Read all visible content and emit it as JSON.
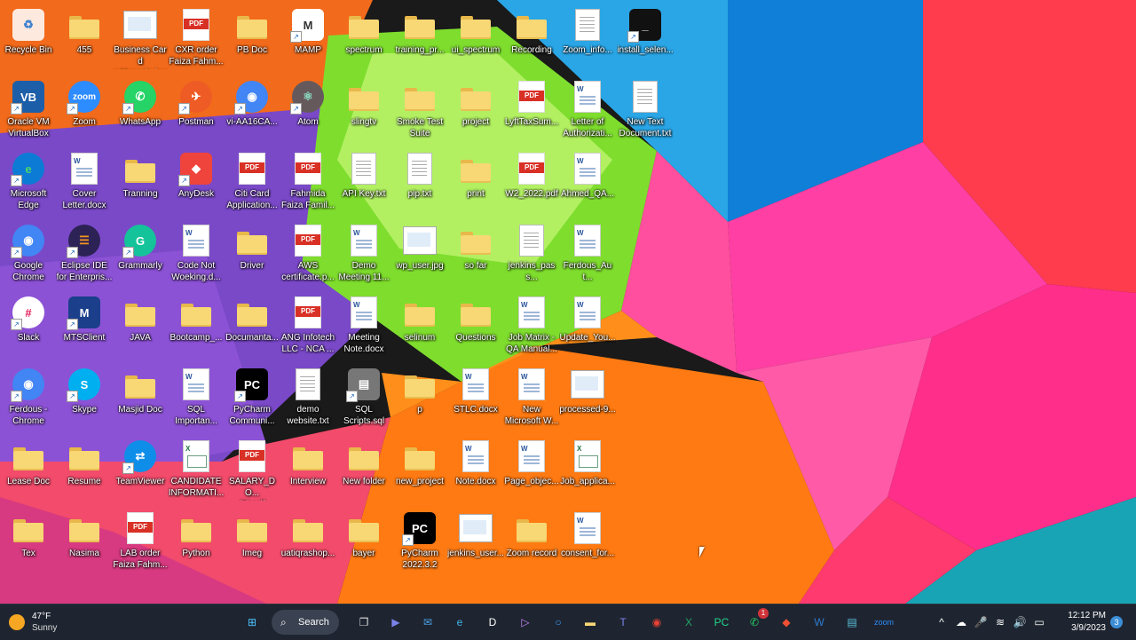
{
  "desktop": {
    "icons": [
      {
        "label": "Recycle Bin",
        "type": "recycle",
        "icon": "recycle-bin-icon"
      },
      {
        "label": "455",
        "type": "folder",
        "icon": "folder-icon"
      },
      {
        "label": "Business Card\nz Hossain.jpg",
        "type": "image",
        "icon": "image-file-icon"
      },
      {
        "label": "CXR order\nFaiza Fahm...",
        "type": "pdf",
        "icon": "pdf-file-icon"
      },
      {
        "label": "PB Doc",
        "type": "folder",
        "icon": "folder-icon"
      },
      {
        "label": "MAMP",
        "type": "app",
        "icon": "mamp-icon",
        "bg": "#ffffff",
        "fg": "#333333",
        "glyph": "M"
      },
      {
        "label": "spectrum",
        "type": "folder",
        "icon": "folder-icon"
      },
      {
        "label": "training_pr...",
        "type": "folder",
        "icon": "folder-icon"
      },
      {
        "label": "ui_spectrum",
        "type": "folder",
        "icon": "folder-icon"
      },
      {
        "label": "Recording",
        "type": "folder",
        "icon": "folder-icon"
      },
      {
        "label": "Zoom_info...",
        "type": "txt",
        "icon": "text-file-icon"
      },
      {
        "label": "install_selen...",
        "type": "app",
        "icon": "console-file-icon",
        "bg": "#111111",
        "fg": "#ffffff",
        "glyph": "_"
      },
      {
        "label": "Oracle VM\nVirtualBox",
        "type": "app",
        "icon": "virtualbox-icon",
        "bg": "#1d5ea8",
        "fg": "#ffffff",
        "glyph": "VB"
      },
      {
        "label": "Zoom",
        "type": "app",
        "icon": "zoom-icon",
        "bg": "#2d8cff",
        "fg": "#ffffff",
        "glyph": "zoom",
        "round": true
      },
      {
        "label": "WhatsApp",
        "type": "app",
        "icon": "whatsapp-icon",
        "bg": "#25d366",
        "fg": "#ffffff",
        "glyph": "✆",
        "round": true
      },
      {
        "label": "Postman",
        "type": "app",
        "icon": "postman-icon",
        "bg": "#ef5b25",
        "fg": "#ffffff",
        "glyph": "✈",
        "round": true
      },
      {
        "label": "vi-AA16CA...",
        "type": "app",
        "icon": "chrome-icon",
        "bg": "#4285f4",
        "fg": "#ffffff",
        "glyph": "◉",
        "round": true
      },
      {
        "label": "Atom",
        "type": "app",
        "icon": "atom-icon",
        "bg": "#66595c",
        "fg": "#8be0c5",
        "glyph": "⚛",
        "round": true
      },
      {
        "label": "slingtv",
        "type": "folder",
        "icon": "folder-icon"
      },
      {
        "label": "Smoke Test\nSuite",
        "type": "folder",
        "icon": "folder-icon"
      },
      {
        "label": "project",
        "type": "folder",
        "icon": "folder-icon"
      },
      {
        "label": "LyftTaxSum...",
        "type": "pdf",
        "icon": "pdf-file-icon"
      },
      {
        "label": "Letter of\nAuthorizati...",
        "type": "doc",
        "icon": "word-file-icon"
      },
      {
        "label": "New Text\nDocument.txt",
        "type": "txt",
        "icon": "text-file-icon"
      },
      {
        "label": "Microsoft\nEdge",
        "type": "app",
        "icon": "edge-icon",
        "bg": "#0c7bd5",
        "fg": "#4fd36c",
        "glyph": "e",
        "round": true
      },
      {
        "label": "Cover\nLetter.docx",
        "type": "doc",
        "icon": "word-file-icon"
      },
      {
        "label": "Tranning",
        "type": "folder",
        "icon": "folder-icon"
      },
      {
        "label": "AnyDesk",
        "type": "app",
        "icon": "anydesk-icon",
        "bg": "#ef443b",
        "fg": "#ffffff",
        "glyph": "◆"
      },
      {
        "label": "Citi Card\nApplication...",
        "type": "pdf",
        "icon": "pdf-file-icon"
      },
      {
        "label": "Fahmida\nFaiza Famil...",
        "type": "pdf",
        "icon": "pdf-file-icon"
      },
      {
        "label": "API Key.txt",
        "type": "txt",
        "icon": "text-file-icon"
      },
      {
        "label": "pip.txt",
        "type": "txt",
        "icon": "text-file-icon"
      },
      {
        "label": "print",
        "type": "folder",
        "icon": "folder-icon"
      },
      {
        "label": "W2_2022.pdf",
        "type": "pdf",
        "icon": "pdf-file-icon"
      },
      {
        "label": "Ahmed_QA...",
        "type": "doc",
        "icon": "word-file-icon"
      },
      {
        "label": "Google\nChrome",
        "type": "app",
        "icon": "chrome-icon",
        "bg": "#4285f4",
        "fg": "#ffffff",
        "glyph": "◉",
        "round": true
      },
      {
        "label": "Eclipse IDE\nfor Enterpris...",
        "type": "app",
        "icon": "eclipse-icon",
        "bg": "#2c2255",
        "fg": "#f7941e",
        "glyph": "☰",
        "round": true
      },
      {
        "label": "Grammarly",
        "type": "app",
        "icon": "grammarly-icon",
        "bg": "#15c39a",
        "fg": "#ffffff",
        "glyph": "G",
        "round": true
      },
      {
        "label": "Code Not\nWoeking.d...",
        "type": "doc",
        "icon": "word-file-icon"
      },
      {
        "label": "Driver",
        "type": "folder",
        "icon": "folder-icon"
      },
      {
        "label": "AWS\ncertificate.p...",
        "type": "pdf",
        "icon": "pdf-file-icon"
      },
      {
        "label": "Demo\nMeeting 11...",
        "type": "doc",
        "icon": "word-file-icon"
      },
      {
        "label": "wp_user.jpg",
        "type": "image",
        "icon": "image-file-icon"
      },
      {
        "label": "so far",
        "type": "folder",
        "icon": "folder-icon"
      },
      {
        "label": "jenkins_pass...",
        "type": "txt",
        "icon": "text-file-icon"
      },
      {
        "label": "Ferdous_Aut...",
        "type": "doc",
        "icon": "word-file-icon"
      },
      {
        "label": "Slack",
        "type": "app",
        "icon": "slack-icon",
        "bg": "#ffffff",
        "fg": "#e01e5a",
        "glyph": "#",
        "round": true
      },
      {
        "label": "MTSClient",
        "type": "app",
        "icon": "mtsclient-icon",
        "bg": "#1b3f8b",
        "fg": "#ffffff",
        "glyph": "M"
      },
      {
        "label": "JAVA",
        "type": "folder",
        "icon": "folder-icon"
      },
      {
        "label": "Bootcamp_...",
        "type": "folder",
        "icon": "folder-icon"
      },
      {
        "label": "Documanta...",
        "type": "folder",
        "icon": "folder-icon"
      },
      {
        "label": "ANG Infotech\nLLC - NCA ...",
        "type": "pdf",
        "icon": "pdf-file-icon"
      },
      {
        "label": "Meeting\nNote.docx",
        "type": "doc",
        "icon": "word-file-icon"
      },
      {
        "label": "selinum",
        "type": "folder",
        "icon": "folder-icon"
      },
      {
        "label": "Questions",
        "type": "folder",
        "icon": "folder-icon"
      },
      {
        "label": "Job Matrix -\nQA Manual...",
        "type": "doc",
        "icon": "word-file-icon"
      },
      {
        "label": "Update_You...",
        "type": "doc",
        "icon": "word-file-icon"
      },
      {
        "label": "Ferdous -\nChrome",
        "type": "app",
        "icon": "chrome-icon",
        "bg": "#4285f4",
        "fg": "#ffffff",
        "glyph": "◉",
        "round": true
      },
      {
        "label": "Skype",
        "type": "app",
        "icon": "skype-icon",
        "bg": "#00aff0",
        "fg": "#ffffff",
        "glyph": "S",
        "round": true
      },
      {
        "label": "Masjid Doc",
        "type": "folder",
        "icon": "folder-icon"
      },
      {
        "label": "SQL\nImportan...",
        "type": "doc",
        "icon": "word-file-icon"
      },
      {
        "label": "PyCharm\nCommuni...",
        "type": "app",
        "icon": "pycharm-icon",
        "bg": "#000000",
        "fg": "#ffffff",
        "glyph": "PC"
      },
      {
        "label": "demo\nwebsite.txt",
        "type": "txt",
        "icon": "text-file-icon"
      },
      {
        "label": "SQL\nScripts.sql",
        "type": "app",
        "icon": "sql-file-icon",
        "bg": "#777777",
        "fg": "#ffffff",
        "glyph": "▤"
      },
      {
        "label": "p",
        "type": "folder",
        "icon": "folder-icon"
      },
      {
        "label": "STLC.docx",
        "type": "doc",
        "icon": "word-file-icon"
      },
      {
        "label": "New\nMicrosoft W...",
        "type": "doc",
        "icon": "word-file-icon"
      },
      {
        "label": "processed-9...",
        "type": "image",
        "icon": "image-file-icon"
      },
      {
        "label": "Lease Doc",
        "type": "folder",
        "icon": "folder-icon"
      },
      {
        "label": "Resume",
        "type": "folder",
        "icon": "folder-icon"
      },
      {
        "label": "TeamViewer",
        "type": "app",
        "icon": "teamviewer-icon",
        "bg": "#0e8ee9",
        "fg": "#ffffff",
        "glyph": "⇄",
        "round": true
      },
      {
        "label": "CANDIDATE\nINFORMATI...",
        "type": "xls",
        "icon": "excel-file-icon"
      },
      {
        "label": "SALARY_DO...\n(1).pdf",
        "type": "pdf",
        "icon": "pdf-file-icon"
      },
      {
        "label": "Interview",
        "type": "folder",
        "icon": "folder-icon"
      },
      {
        "label": "New folder",
        "type": "folder",
        "icon": "folder-icon"
      },
      {
        "label": "new_project",
        "type": "folder",
        "icon": "folder-icon"
      },
      {
        "label": "Note.docx",
        "type": "doc",
        "icon": "word-file-icon"
      },
      {
        "label": "Page_objec...",
        "type": "doc",
        "icon": "word-file-icon"
      },
      {
        "label": "Job_applica...",
        "type": "xls",
        "icon": "excel-file-icon"
      },
      {
        "label": "Tex",
        "type": "folder",
        "icon": "folder-icon"
      },
      {
        "label": "Nasima",
        "type": "folder",
        "icon": "folder-icon"
      },
      {
        "label": "LAB order\nFaiza Fahm...",
        "type": "pdf",
        "icon": "pdf-file-icon"
      },
      {
        "label": "Python",
        "type": "folder",
        "icon": "folder-icon"
      },
      {
        "label": "Imeg",
        "type": "folder",
        "icon": "folder-icon"
      },
      {
        "label": "uatiqrashop...",
        "type": "folder",
        "icon": "folder-icon"
      },
      {
        "label": "bayer",
        "type": "folder",
        "icon": "folder-icon"
      },
      {
        "label": "PyCharm\n2022.3.2",
        "type": "app",
        "icon": "pycharm-icon",
        "bg": "#000000",
        "fg": "#ffffff",
        "glyph": "PC"
      },
      {
        "label": "jenkins_user...",
        "type": "image",
        "icon": "image-file-icon"
      },
      {
        "label": "Zoom record",
        "type": "folder",
        "icon": "folder-icon"
      },
      {
        "label": "consent_for...",
        "type": "doc",
        "icon": "word-file-icon"
      }
    ]
  },
  "taskbar": {
    "weather": {
      "temp": "47°F",
      "condition": "Sunny"
    },
    "search_label": "Search",
    "apps": [
      {
        "name": "start-button",
        "glyph": "⊞",
        "color": "#4cc2ff"
      },
      {
        "name": "task-view-icon",
        "glyph": "❐",
        "color": "#dddddd"
      },
      {
        "name": "teams-meet-icon",
        "glyph": "▶",
        "color": "#7b83eb"
      },
      {
        "name": "mail-icon",
        "glyph": "✉",
        "color": "#4aa0e6"
      },
      {
        "name": "edge-icon",
        "glyph": "e",
        "color": "#3fb6ea"
      },
      {
        "name": "dell-icon",
        "glyph": "D",
        "color": "#ffffff"
      },
      {
        "name": "media-player-icon",
        "glyph": "▷",
        "color": "#c987ff"
      },
      {
        "name": "cortana-icon",
        "glyph": "○",
        "color": "#3aa0ff"
      },
      {
        "name": "file-explorer-icon",
        "glyph": "▬",
        "color": "#f8d775"
      },
      {
        "name": "teams-icon",
        "glyph": "T",
        "color": "#7b83eb"
      },
      {
        "name": "chrome-icon",
        "glyph": "◉",
        "color": "#e94235"
      },
      {
        "name": "excel-icon",
        "glyph": "X",
        "color": "#21a366"
      },
      {
        "name": "pycharm-icon",
        "glyph": "PC",
        "color": "#21d789"
      },
      {
        "name": "whatsapp-icon",
        "glyph": "✆",
        "color": "#25d366",
        "badge": "1"
      },
      {
        "name": "git-icon",
        "glyph": "◆",
        "color": "#f05033"
      },
      {
        "name": "word-icon",
        "glyph": "W",
        "color": "#2b7cd3"
      },
      {
        "name": "notepad-icon",
        "glyph": "▤",
        "color": "#5bc0de"
      },
      {
        "name": "zoom-icon",
        "glyph": "zoom",
        "color": "#2d8cff"
      }
    ],
    "tray": [
      {
        "name": "chevron-up-icon",
        "glyph": "^"
      },
      {
        "name": "security-icon",
        "glyph": "☁"
      },
      {
        "name": "microphone-icon",
        "glyph": "🎤"
      },
      {
        "name": "wifi-icon",
        "glyph": "≋"
      },
      {
        "name": "volume-icon",
        "glyph": "🔊"
      },
      {
        "name": "battery-icon",
        "glyph": "▭"
      }
    ],
    "time": "12:12 PM",
    "date": "3/9/2023",
    "notifications": "3"
  }
}
